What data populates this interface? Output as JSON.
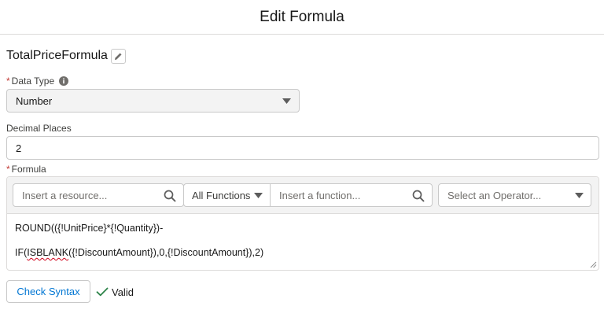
{
  "header": {
    "title": "Edit Formula"
  },
  "formula": {
    "name": "TotalPriceFormula",
    "edit_icon": "pencil-icon"
  },
  "data_type": {
    "required_marker": "*",
    "label": "Data Type",
    "info_icon": "info-icon",
    "value": "Number"
  },
  "decimal_places": {
    "label": "Decimal Places",
    "value": "2"
  },
  "formula_field": {
    "required_marker": "*",
    "label": "Formula",
    "resource_search": {
      "placeholder": "Insert a resource...",
      "icon": "search-icon"
    },
    "function_category": {
      "value": "All Functions"
    },
    "function_search": {
      "placeholder": "Insert a function...",
      "icon": "search-icon"
    },
    "operator_select": {
      "placeholder": "Select an Operator..."
    },
    "lines": {
      "line1": "ROUND(({!UnitPrice}*{!Quantity})-",
      "line2_word": "ISBLANK",
      "line2_prefix": "IF(",
      "line2_rest": "({!DiscountAmount}),0,{!DiscountAmount}),2)"
    }
  },
  "actions": {
    "check_syntax": "Check Syntax",
    "status": "Valid",
    "status_color": "#2e844a"
  },
  "colors": {
    "link": "#0176d3",
    "required": "#c23934",
    "toolbar_bg": "#f3f3f3"
  }
}
